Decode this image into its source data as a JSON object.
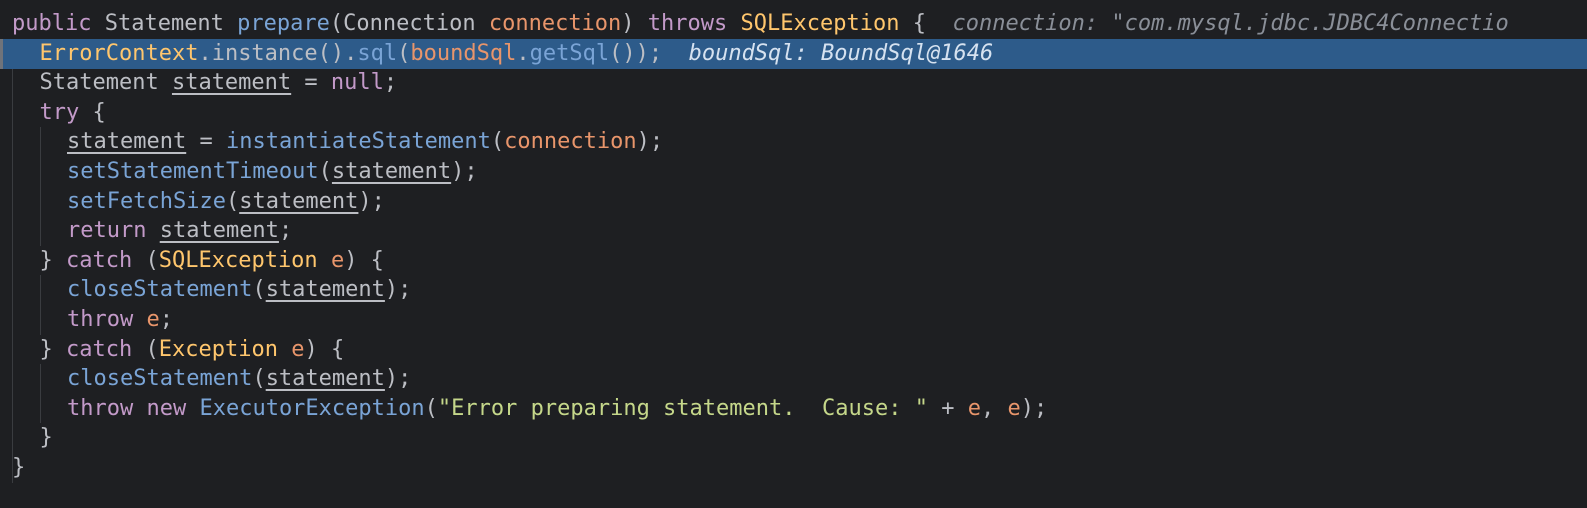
{
  "editor": {
    "language": "java",
    "lines": [
      {
        "indent": 0,
        "tokens": [
          {
            "t": "public ",
            "c": "t-kw2"
          },
          {
            "t": "Statement ",
            "c": "t-ty"
          },
          {
            "t": "prepare",
            "c": "t-mth"
          },
          {
            "t": "(",
            "c": "t-plain"
          },
          {
            "t": "Connection ",
            "c": "t-ty"
          },
          {
            "t": "connection",
            "c": "t-prm"
          },
          {
            "t": ") ",
            "c": "t-plain"
          },
          {
            "t": "throws ",
            "c": "t-kw2"
          },
          {
            "t": "SQLException",
            "c": "t-yel"
          },
          {
            "t": " {",
            "c": "t-plain"
          }
        ],
        "hint": "  connection: \"com.mysql.jdbc.JDBC4Connectio"
      },
      {
        "indent": 1,
        "current": true,
        "tokens": [
          {
            "t": "ErrorContext",
            "c": "t-yel"
          },
          {
            "t": ".instance().",
            "c": "t-plain"
          },
          {
            "t": "sql",
            "c": "t-mth"
          },
          {
            "t": "(",
            "c": "t-plain"
          },
          {
            "t": "boundSql",
            "c": "t-prm"
          },
          {
            "t": ".",
            "c": "t-plain"
          },
          {
            "t": "getSql",
            "c": "t-mth"
          },
          {
            "t": "());",
            "c": "t-plain"
          }
        ],
        "hint": "  boundSql: BoundSql@1646"
      },
      {
        "indent": 1,
        "tokens": [
          {
            "t": "Statement ",
            "c": "t-ty"
          },
          {
            "t": "statement",
            "c": "t-var"
          },
          {
            "t": " = ",
            "c": "t-plain"
          },
          {
            "t": "null",
            "c": "t-kw2"
          },
          {
            "t": ";",
            "c": "t-plain"
          }
        ]
      },
      {
        "indent": 1,
        "tokens": [
          {
            "t": "try",
            "c": "t-kw2"
          },
          {
            "t": " {",
            "c": "t-plain"
          }
        ]
      },
      {
        "indent": 2,
        "tokens": [
          {
            "t": "statement",
            "c": "t-var"
          },
          {
            "t": " = ",
            "c": "t-plain"
          },
          {
            "t": "instantiateStatement",
            "c": "t-mth"
          },
          {
            "t": "(",
            "c": "t-plain"
          },
          {
            "t": "connection",
            "c": "t-prm"
          },
          {
            "t": ");",
            "c": "t-plain"
          }
        ]
      },
      {
        "indent": 2,
        "tokens": [
          {
            "t": "setStatementTimeout",
            "c": "t-mth"
          },
          {
            "t": "(",
            "c": "t-plain"
          },
          {
            "t": "statement",
            "c": "t-var"
          },
          {
            "t": ");",
            "c": "t-plain"
          }
        ]
      },
      {
        "indent": 2,
        "tokens": [
          {
            "t": "setFetchSize",
            "c": "t-mth"
          },
          {
            "t": "(",
            "c": "t-plain"
          },
          {
            "t": "statement",
            "c": "t-var"
          },
          {
            "t": ");",
            "c": "t-plain"
          }
        ]
      },
      {
        "indent": 2,
        "tokens": [
          {
            "t": "return ",
            "c": "t-kw2"
          },
          {
            "t": "statement",
            "c": "t-var"
          },
          {
            "t": ";",
            "c": "t-plain"
          }
        ]
      },
      {
        "indent": 1,
        "tokens": [
          {
            "t": "} ",
            "c": "t-plain"
          },
          {
            "t": "catch",
            "c": "t-kw2"
          },
          {
            "t": " (",
            "c": "t-plain"
          },
          {
            "t": "SQLException",
            "c": "t-yel"
          },
          {
            "t": " ",
            "c": "t-plain"
          },
          {
            "t": "e",
            "c": "t-prm"
          },
          {
            "t": ") {",
            "c": "t-plain"
          }
        ]
      },
      {
        "indent": 2,
        "tokens": [
          {
            "t": "closeStatement",
            "c": "t-mth"
          },
          {
            "t": "(",
            "c": "t-plain"
          },
          {
            "t": "statement",
            "c": "t-var"
          },
          {
            "t": ");",
            "c": "t-plain"
          }
        ]
      },
      {
        "indent": 2,
        "tokens": [
          {
            "t": "throw ",
            "c": "t-kw2"
          },
          {
            "t": "e",
            "c": "t-prm"
          },
          {
            "t": ";",
            "c": "t-plain"
          }
        ]
      },
      {
        "indent": 1,
        "tokens": [
          {
            "t": "} ",
            "c": "t-plain"
          },
          {
            "t": "catch",
            "c": "t-kw2"
          },
          {
            "t": " (",
            "c": "t-plain"
          },
          {
            "t": "Exception",
            "c": "t-yel"
          },
          {
            "t": " ",
            "c": "t-plain"
          },
          {
            "t": "e",
            "c": "t-prm"
          },
          {
            "t": ") {",
            "c": "t-plain"
          }
        ]
      },
      {
        "indent": 2,
        "tokens": [
          {
            "t": "closeStatement",
            "c": "t-mth"
          },
          {
            "t": "(",
            "c": "t-plain"
          },
          {
            "t": "statement",
            "c": "t-var"
          },
          {
            "t": ");",
            "c": "t-plain"
          }
        ]
      },
      {
        "indent": 2,
        "tokens": [
          {
            "t": "throw ",
            "c": "t-kw2"
          },
          {
            "t": "new ",
            "c": "t-kw2"
          },
          {
            "t": "ExecutorException",
            "c": "t-mth"
          },
          {
            "t": "(",
            "c": "t-plain"
          },
          {
            "t": "\"Error preparing statement.  Cause: \"",
            "c": "t-str"
          },
          {
            "t": " + ",
            "c": "t-plain"
          },
          {
            "t": "e",
            "c": "t-prm"
          },
          {
            "t": ", ",
            "c": "t-plain"
          },
          {
            "t": "e",
            "c": "t-prm"
          },
          {
            "t": ");",
            "c": "t-plain"
          }
        ]
      },
      {
        "indent": 1,
        "tokens": [
          {
            "t": "}",
            "c": "t-plain"
          }
        ]
      },
      {
        "indent": 0,
        "tokens": [
          {
            "t": "}",
            "c": "t-plain"
          }
        ]
      }
    ]
  },
  "colors": {
    "background": "#1e1f22",
    "current_line": "#2d5b8a",
    "keyword": "#c39ac9",
    "method": "#7aa4d6",
    "parameter": "#e8956b",
    "type_highlight": "#ffc66d",
    "string": "#c5d78a",
    "inlay_hint": "#8a8f98"
  }
}
